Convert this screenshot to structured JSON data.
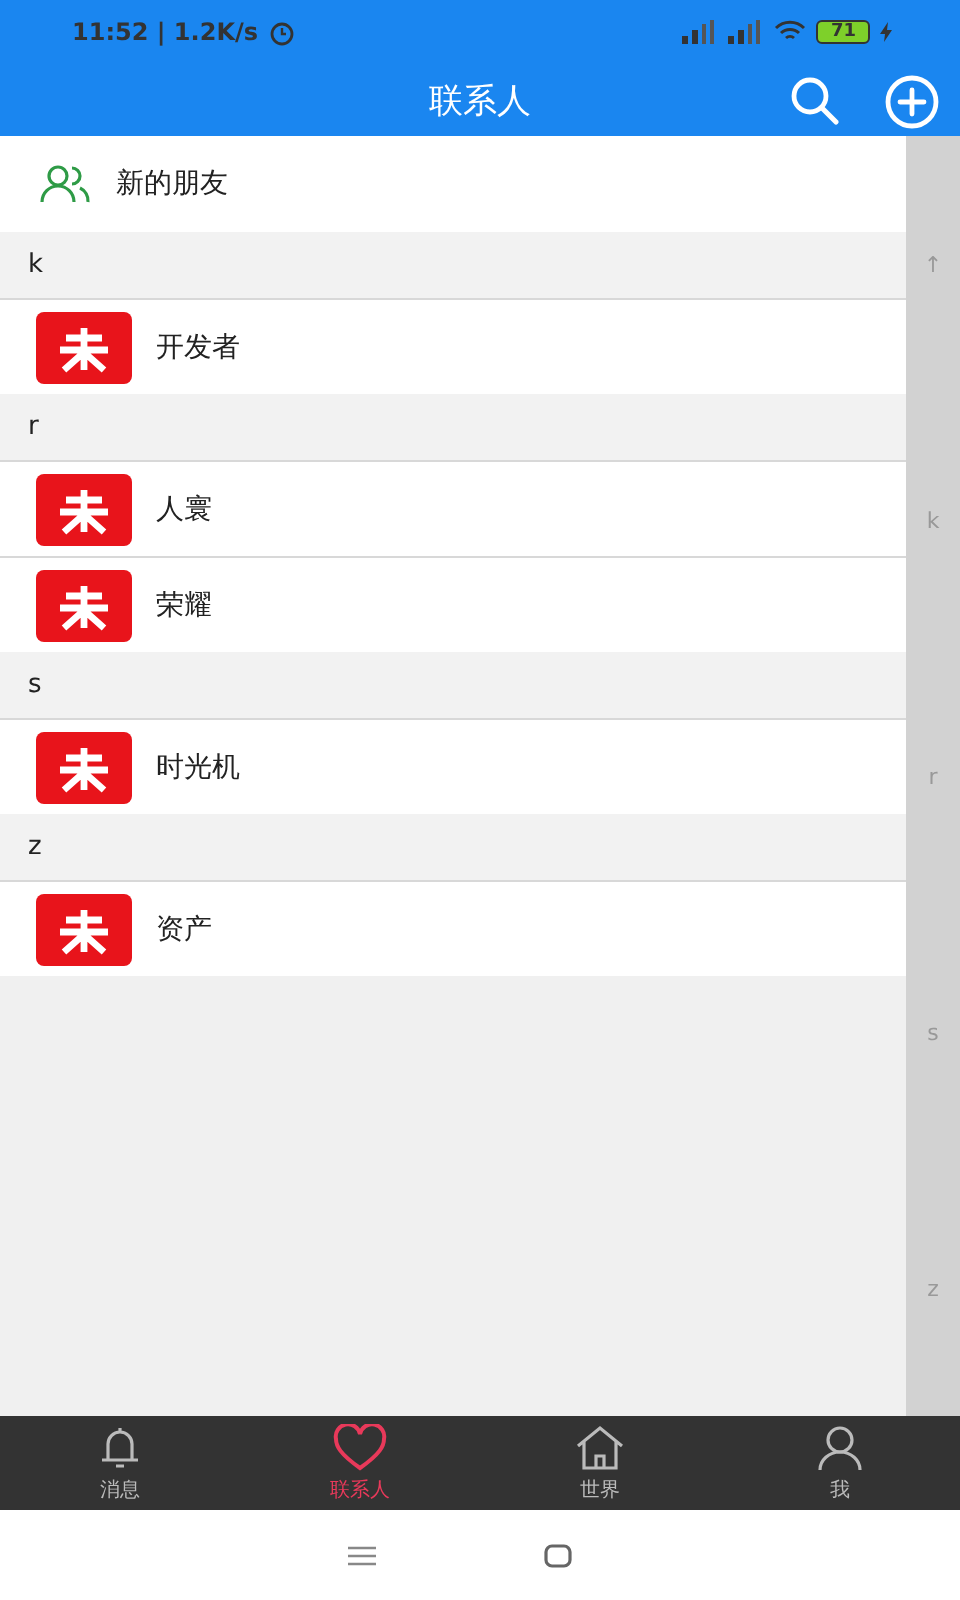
{
  "status_bar": {
    "time": "11:52 | 1.2K/s",
    "battery": "71"
  },
  "header": {
    "title": "联系人"
  },
  "new_friends": {
    "label": "新的朋友"
  },
  "sections": [
    {
      "letter": "k",
      "contacts": [
        {
          "name": "开发者"
        }
      ]
    },
    {
      "letter": "r",
      "contacts": [
        {
          "name": "人寰"
        },
        {
          "name": "荣耀"
        }
      ]
    },
    {
      "letter": "s",
      "contacts": [
        {
          "name": "时光机"
        }
      ]
    },
    {
      "letter": "z",
      "contacts": [
        {
          "name": "资产"
        }
      ]
    }
  ],
  "index_bar": [
    "↑",
    "k",
    "r",
    "s",
    "z"
  ],
  "tabs": [
    {
      "label": "消息",
      "kind": "bell",
      "selected": false
    },
    {
      "label": "联系人",
      "kind": "heart",
      "selected": true
    },
    {
      "label": "世界",
      "kind": "home",
      "selected": false
    },
    {
      "label": "我",
      "kind": "person",
      "selected": false
    }
  ]
}
